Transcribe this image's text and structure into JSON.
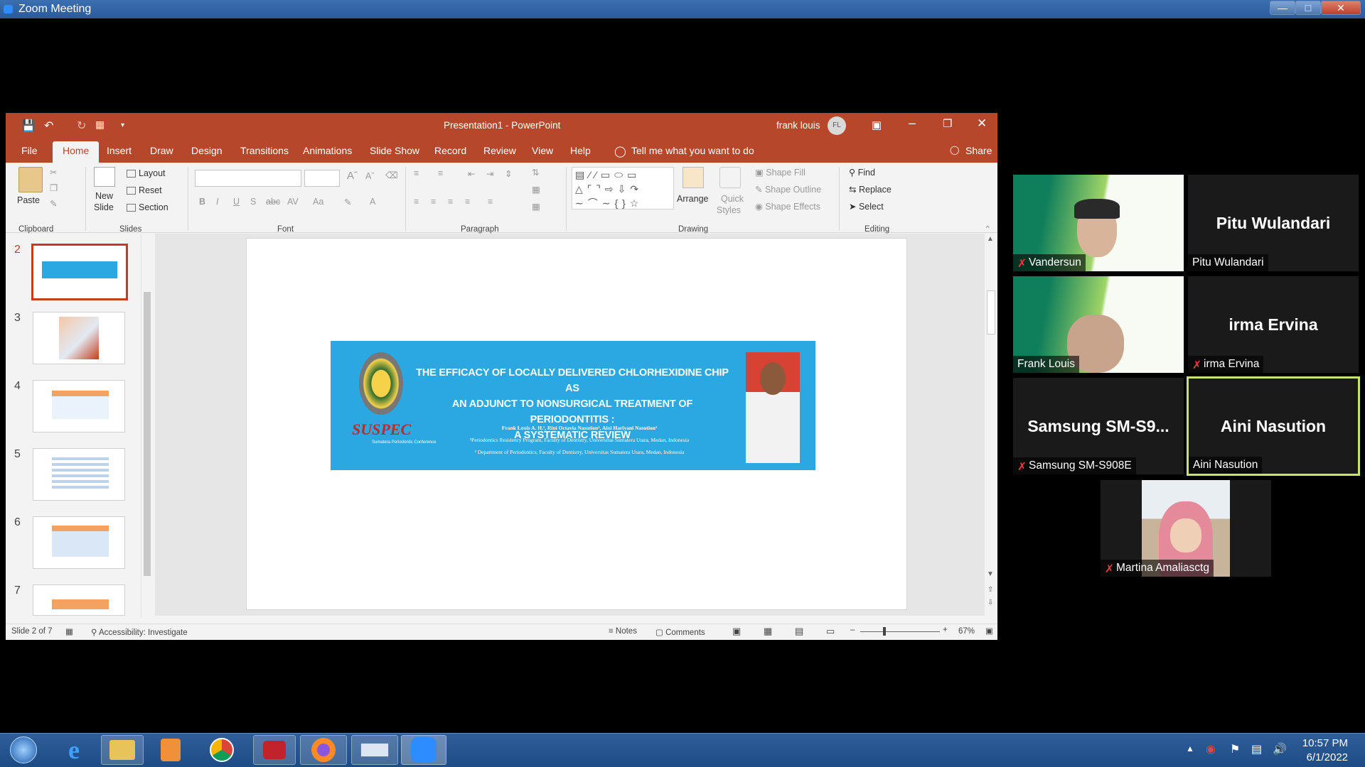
{
  "zoom": {
    "title": "Zoom Meeting"
  },
  "ppt": {
    "title": "Presentation1  -  PowerPoint",
    "user": "frank louis",
    "user_initials": "FL",
    "tabs": [
      "File",
      "Home",
      "Insert",
      "Draw",
      "Design",
      "Transitions",
      "Animations",
      "Slide Show",
      "Record",
      "Review",
      "View",
      "Help"
    ],
    "tell_me": "Tell me what you want to do",
    "share": "Share",
    "ribbon": {
      "paste": "Paste",
      "new_slide_1": "New",
      "new_slide_2": "Slide",
      "layout": "Layout",
      "reset": "Reset",
      "section": "Section",
      "arrange": "Arrange",
      "quick_styles_1": "Quick",
      "quick_styles_2": "Styles",
      "shape_fill": "Shape Fill",
      "shape_outline": "Shape Outline",
      "shape_effects": "Shape Effects",
      "find": "Find",
      "replace": "Replace",
      "select": "Select",
      "groups": {
        "clipboard": "Clipboard",
        "slides": "Slides",
        "font": "Font",
        "paragraph": "Paragraph",
        "drawing": "Drawing",
        "editing": "Editing"
      }
    },
    "thumbnails": [
      "2",
      "3",
      "4",
      "5",
      "6",
      "7"
    ],
    "slide": {
      "title_lines": [
        "THE EFFICACY OF LOCALLY DELIVERED CHLORHEXIDINE CHIP AS",
        "AN ADJUNCT TO NONSURGICAL TREATMENT OF PERIODONTITIS :",
        "A SYSTEMATIC REVIEW"
      ],
      "authors": "Frank Louis A. H.¹, Rini Octavia Nasution², Aini Hariyani Nasution²",
      "affil_1": "¹Periodontics Residency Program, Faculty of Dentistry, Universitas Sumatera Utara, Medan, Indonesia",
      "affil_2": "² Department of Periodontics, Faculty of Dentistry, Universitas Sumatera Utara, Medan, Indonesia",
      "logo_text": "SUSPEC",
      "logo_sub": "Sumatera Periodontic Conference"
    },
    "status": {
      "slide_info": "Slide 2 of 7",
      "accessibility": "Accessibility: Investigate",
      "notes": "Notes",
      "comments": "Comments",
      "zoom": "67%"
    }
  },
  "participants": [
    {
      "name": "Vandersun",
      "muted": true,
      "video": true
    },
    {
      "name": "Pitu Wulandari",
      "big": "Pitu Wulandari",
      "muted": false,
      "video": false
    },
    {
      "name": "Frank Louis",
      "muted": false,
      "video": true
    },
    {
      "name": "irma Ervina",
      "big": "irma Ervina",
      "muted": true,
      "video": false
    },
    {
      "name": "Samsung SM-S908E",
      "big": "Samsung  SM-S9...",
      "muted": true,
      "video": false
    },
    {
      "name": "Aini Nasution",
      "big": "Aini Nasution",
      "muted": false,
      "video": false,
      "active_speaker": true
    },
    {
      "name": "Martina Amaliasctg",
      "muted": true,
      "video": true
    }
  ],
  "taskbar": {
    "time": "10:57 PM",
    "date": "6/1/2022"
  },
  "colors": {
    "ppt_accent": "#b7472a",
    "slide_banner": "#2ba7e2",
    "active_speaker": "#c6e36a"
  }
}
